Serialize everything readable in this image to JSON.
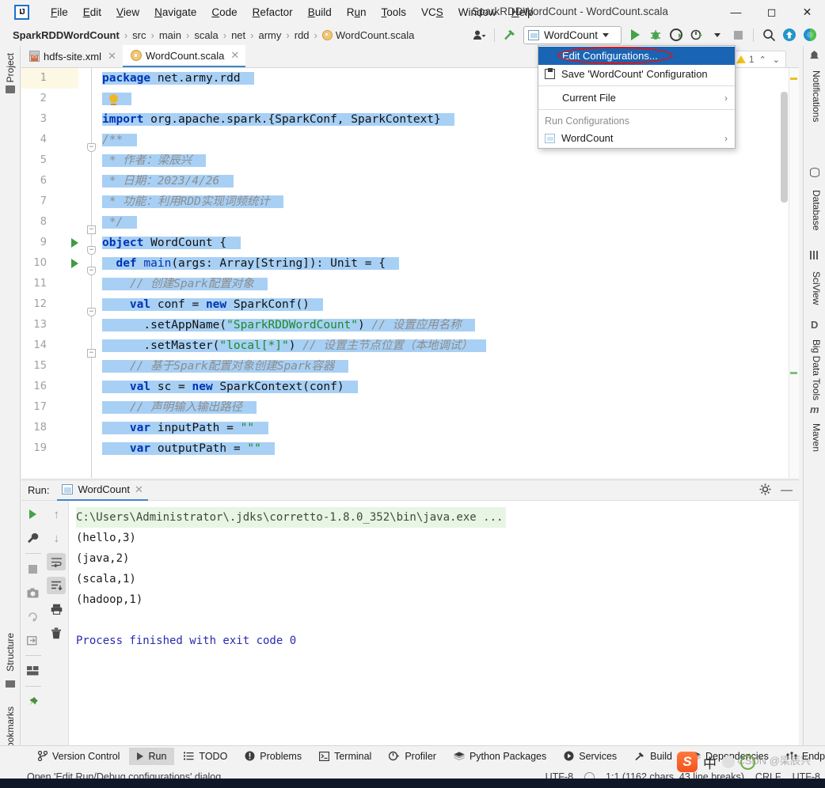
{
  "window": {
    "title": "SparkRDDWordCount - WordCount.scala",
    "logo_text": "IJ",
    "minimize": "—",
    "maximize": "☐",
    "close": "✕"
  },
  "menubar": {
    "items": [
      {
        "label": "File",
        "name": "menu-file"
      },
      {
        "label": "Edit",
        "name": "menu-edit"
      },
      {
        "label": "View",
        "name": "menu-view"
      },
      {
        "label": "Navigate",
        "name": "menu-navigate"
      },
      {
        "label": "Code",
        "name": "menu-code"
      },
      {
        "label": "Refactor",
        "name": "menu-refactor"
      },
      {
        "label": "Build",
        "name": "menu-build"
      },
      {
        "label": "Run",
        "name": "menu-run"
      },
      {
        "label": "Tools",
        "name": "menu-tools"
      },
      {
        "label": "VCS",
        "name": "menu-vcs"
      },
      {
        "label": "Window",
        "name": "menu-window"
      },
      {
        "label": "Help",
        "name": "menu-help"
      }
    ]
  },
  "breadcrumb": {
    "items": [
      "SparkRDDWordCount",
      "src",
      "main",
      "scala",
      "net",
      "army",
      "rdd",
      "WordCount.scala"
    ],
    "separator": "›"
  },
  "toolbar": {
    "run_config_label": "WordCount",
    "icons": [
      "profiles-icon",
      "build-hammer-icon",
      "run-icon",
      "debug-icon",
      "run-coverage-icon",
      "profiler-icon",
      "stop-icon",
      "search-icon",
      "update-project-icon",
      "ide-feature-icon"
    ]
  },
  "run_dropdown": {
    "edit_configurations": "Edit Configurations...",
    "save_configuration": "Save 'WordCount' Configuration",
    "current_file": "Current File",
    "section_label": "Run Configurations",
    "wordcount": "WordCount",
    "arrow": "›"
  },
  "editor": {
    "tabs": [
      {
        "label": "hdfs-site.xml",
        "icon": "xml-file-icon",
        "active": false
      },
      {
        "label": "WordCount.scala",
        "icon": "scala-object-icon",
        "active": true
      }
    ],
    "close_glyph": "✕",
    "warning_badge": {
      "count": "1",
      "up": "⌃",
      "down": "⌄"
    },
    "line_numbers": [
      "1",
      "2",
      "3",
      "4",
      "5",
      "6",
      "7",
      "8",
      "9",
      "10",
      "11",
      "12",
      "13",
      "14",
      "15",
      "16",
      "17",
      "18",
      "19"
    ],
    "lines": [
      {
        "n": 1,
        "tokens": [
          {
            "t": "package ",
            "c": "kw"
          },
          {
            "t": "net.army.rdd",
            "c": "plain"
          }
        ]
      },
      {
        "n": 2,
        "tokens": [],
        "bulb": true
      },
      {
        "n": 3,
        "tokens": [
          {
            "t": "import ",
            "c": "kw"
          },
          {
            "t": "org.apache.spark.{SparkConf, SparkContext}",
            "c": "plain"
          }
        ]
      },
      {
        "n": 4,
        "tokens": [
          {
            "t": "/**",
            "c": "cmt"
          }
        ]
      },
      {
        "n": 5,
        "tokens": [
          {
            "t": " * 作者：梁辰兴",
            "c": "cmt"
          }
        ]
      },
      {
        "n": 6,
        "tokens": [
          {
            "t": " * 日期：2023/4/26",
            "c": "cmt"
          }
        ]
      },
      {
        "n": 7,
        "tokens": [
          {
            "t": " * 功能：利用RDD实现词频统计",
            "c": "cmt"
          }
        ]
      },
      {
        "n": 8,
        "tokens": [
          {
            "t": " */",
            "c": "cmt"
          }
        ]
      },
      {
        "n": 9,
        "tokens": [
          {
            "t": "object ",
            "c": "kw"
          },
          {
            "t": "WordCount {",
            "c": "plain"
          }
        ]
      },
      {
        "n": 10,
        "tokens": [
          {
            "t": "  ",
            "c": "plain"
          },
          {
            "t": "def ",
            "c": "kw"
          },
          {
            "t": "main",
            "c": "kw2"
          },
          {
            "t": "(args: Array[String]): Unit = {",
            "c": "plain"
          }
        ]
      },
      {
        "n": 11,
        "tokens": [
          {
            "t": "    // 创建Spark配置对象",
            "c": "cmt"
          }
        ]
      },
      {
        "n": 12,
        "tokens": [
          {
            "t": "    ",
            "c": "plain"
          },
          {
            "t": "val ",
            "c": "kw"
          },
          {
            "t": "conf = ",
            "c": "plain"
          },
          {
            "t": "new ",
            "c": "kw"
          },
          {
            "t": "SparkConf()",
            "c": "plain"
          }
        ]
      },
      {
        "n": 13,
        "tokens": [
          {
            "t": "      .setAppName(",
            "c": "plain"
          },
          {
            "t": "\"SparkRDDWordCount\"",
            "c": "str"
          },
          {
            "t": ") ",
            "c": "plain"
          },
          {
            "t": "// 设置应用名称",
            "c": "cmt"
          }
        ]
      },
      {
        "n": 14,
        "tokens": [
          {
            "t": "      .setMaster(",
            "c": "plain"
          },
          {
            "t": "\"local[*]\"",
            "c": "str"
          },
          {
            "t": ") ",
            "c": "plain"
          },
          {
            "t": "// 设置主节点位置（本地调试）",
            "c": "cmt"
          }
        ]
      },
      {
        "n": 15,
        "tokens": [
          {
            "t": "    // 基于Spark配置对象创建Spark容器",
            "c": "cmt"
          }
        ]
      },
      {
        "n": 16,
        "tokens": [
          {
            "t": "    ",
            "c": "plain"
          },
          {
            "t": "val ",
            "c": "kw"
          },
          {
            "t": "sc = ",
            "c": "plain"
          },
          {
            "t": "new ",
            "c": "kw"
          },
          {
            "t": "SparkContext(conf)",
            "c": "plain"
          }
        ]
      },
      {
        "n": 17,
        "tokens": [
          {
            "t": "    // 声明输入输出路径",
            "c": "cmt"
          }
        ]
      },
      {
        "n": 18,
        "tokens": [
          {
            "t": "    ",
            "c": "plain"
          },
          {
            "t": "var ",
            "c": "kw"
          },
          {
            "t": "inputPath = ",
            "c": "plain"
          },
          {
            "t": "\"\"",
            "c": "str"
          }
        ]
      },
      {
        "n": 19,
        "tokens": [
          {
            "t": "    ",
            "c": "plain"
          },
          {
            "t": "var ",
            "c": "kw"
          },
          {
            "t": "outputPath = ",
            "c": "plain"
          },
          {
            "t": "\"\"",
            "c": "str"
          }
        ]
      }
    ]
  },
  "run_panel": {
    "label": "Run:",
    "tab_label": "WordCount",
    "close_glyph": "✕",
    "console": [
      {
        "text": "C:\\Users\\Administrator\\.jdks\\corretto-1.8.0_352\\bin\\java.exe ...",
        "style": "path"
      },
      {
        "text": "(hello,3)",
        "style": "normal"
      },
      {
        "text": "(java,2)",
        "style": "normal"
      },
      {
        "text": "(scala,1)",
        "style": "normal"
      },
      {
        "text": "(hadoop,1)",
        "style": "normal"
      },
      {
        "text": "",
        "style": "normal"
      },
      {
        "text": "Process finished with exit code 0",
        "style": "exit"
      }
    ],
    "tool_icons": [
      "rerun-icon",
      "settings-wrench-icon",
      "stop-icon",
      "screenshot-icon",
      "restart-icon",
      "export-icon",
      "layout-icon",
      "pin-icon",
      "scroll-up-icon",
      "scroll-down-icon",
      "soft-wrap-icon",
      "scroll-end-icon",
      "print-icon",
      "trash-icon"
    ]
  },
  "left_stripe": {
    "items": [
      {
        "label": "Project",
        "icon": "project-folder-icon"
      },
      {
        "label": "Structure",
        "icon": "structure-icon"
      },
      {
        "label": "Bookmarks",
        "icon": "bookmark-icon"
      }
    ]
  },
  "right_stripe": {
    "items": [
      {
        "label": "Notifications",
        "icon": "bell-icon"
      },
      {
        "label": "Database",
        "icon": "database-icon"
      },
      {
        "label": "SciView",
        "icon": "sciview-grid-icon"
      },
      {
        "label": "Big Data Tools",
        "icon": "big-data-tools-icon"
      },
      {
        "label": "Maven",
        "icon": "maven-icon"
      }
    ]
  },
  "bottom_bar": {
    "items": [
      {
        "label": "Version Control",
        "icon": "branch-icon",
        "active": false
      },
      {
        "label": "Run",
        "icon": "run-icon",
        "active": true
      },
      {
        "label": "TODO",
        "icon": "todo-list-icon",
        "active": false
      },
      {
        "label": "Problems",
        "icon": "problems-icon",
        "active": false
      },
      {
        "label": "Terminal",
        "icon": "terminal-icon",
        "active": false
      },
      {
        "label": "Profiler",
        "icon": "profiler-icon",
        "active": false
      },
      {
        "label": "Python Packages",
        "icon": "layers-icon",
        "active": false
      },
      {
        "label": "Services",
        "icon": "services-icon",
        "active": false
      },
      {
        "label": "Build",
        "icon": "hammer-icon",
        "active": false
      },
      {
        "label": "Dependencies",
        "icon": "layers-icon",
        "active": false
      },
      {
        "label": "Endpoints",
        "icon": "endpoints-icon",
        "active": false
      }
    ]
  },
  "status_bar": {
    "message": "Open 'Edit Run/Debug configurations' dialog",
    "encoding_left": "UTF-8",
    "caret": "1:1 (1162 chars, 43 line breaks)",
    "line_sep": "CRLF",
    "encoding": "UTF-8"
  },
  "watermark": "CSDN @梁辰兴",
  "ime": {
    "logo": "S",
    "label": "中"
  }
}
